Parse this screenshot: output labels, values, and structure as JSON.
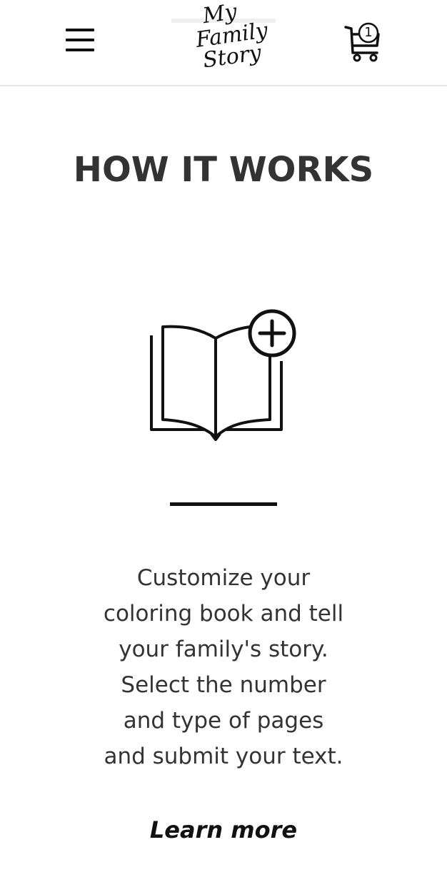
{
  "header": {
    "logo": {
      "line1": "My",
      "line2": "Family",
      "line3": "Story"
    },
    "cart": {
      "count": "1"
    }
  },
  "main": {
    "title": "HOW IT WORKS",
    "description": "Customize your coloring book and tell your family's story. Select the number and type of pages and submit your text.",
    "learn_more_label": "Learn more"
  },
  "icons": {
    "menu": "hamburger-menu-icon",
    "cart": "shopping-cart-icon",
    "feature": "open-book-plus-icon"
  },
  "colors": {
    "text": "#333333",
    "ink": "#111111",
    "background": "#ffffff",
    "header_border": "#e6e6e6"
  }
}
